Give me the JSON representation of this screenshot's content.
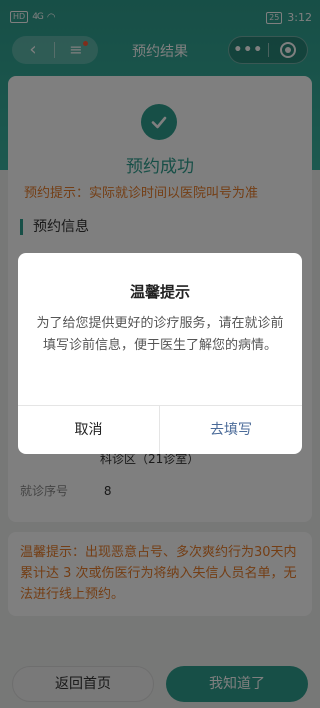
{
  "status_bar": {
    "network": "HD",
    "signal": "4G",
    "battery": "25",
    "time": "3:12"
  },
  "nav": {
    "back_icon": "‹",
    "menu_icon": "≡",
    "title": "预约结果",
    "more_icon": "•••"
  },
  "result": {
    "title": "预约成功",
    "tip": "预约提示：实际就诊时间以医院叫号为准",
    "section_title": "预约信息",
    "department_fragment": "科诊区（21诊室）",
    "queue_label": "就诊序号",
    "queue_value": "8"
  },
  "warning": {
    "text": "温馨提示：出现恶意占号、多次爽约行为30天内累计达 3 次或伤医行为将纳入失信人员名单，无法进行线上预约。"
  },
  "bottom": {
    "home_label": "返回首页",
    "ok_label": "我知道了"
  },
  "modal": {
    "title": "温馨提示",
    "content": "为了给您提供更好的诊疗服务，请在就诊前填写诊前信息，便于医生了解您的病情。",
    "cancel_label": "取消",
    "confirm_label": "去填写"
  },
  "colors": {
    "primary": "#2f9e8e",
    "warning": "#e87d2a",
    "link": "#4a6a98"
  }
}
